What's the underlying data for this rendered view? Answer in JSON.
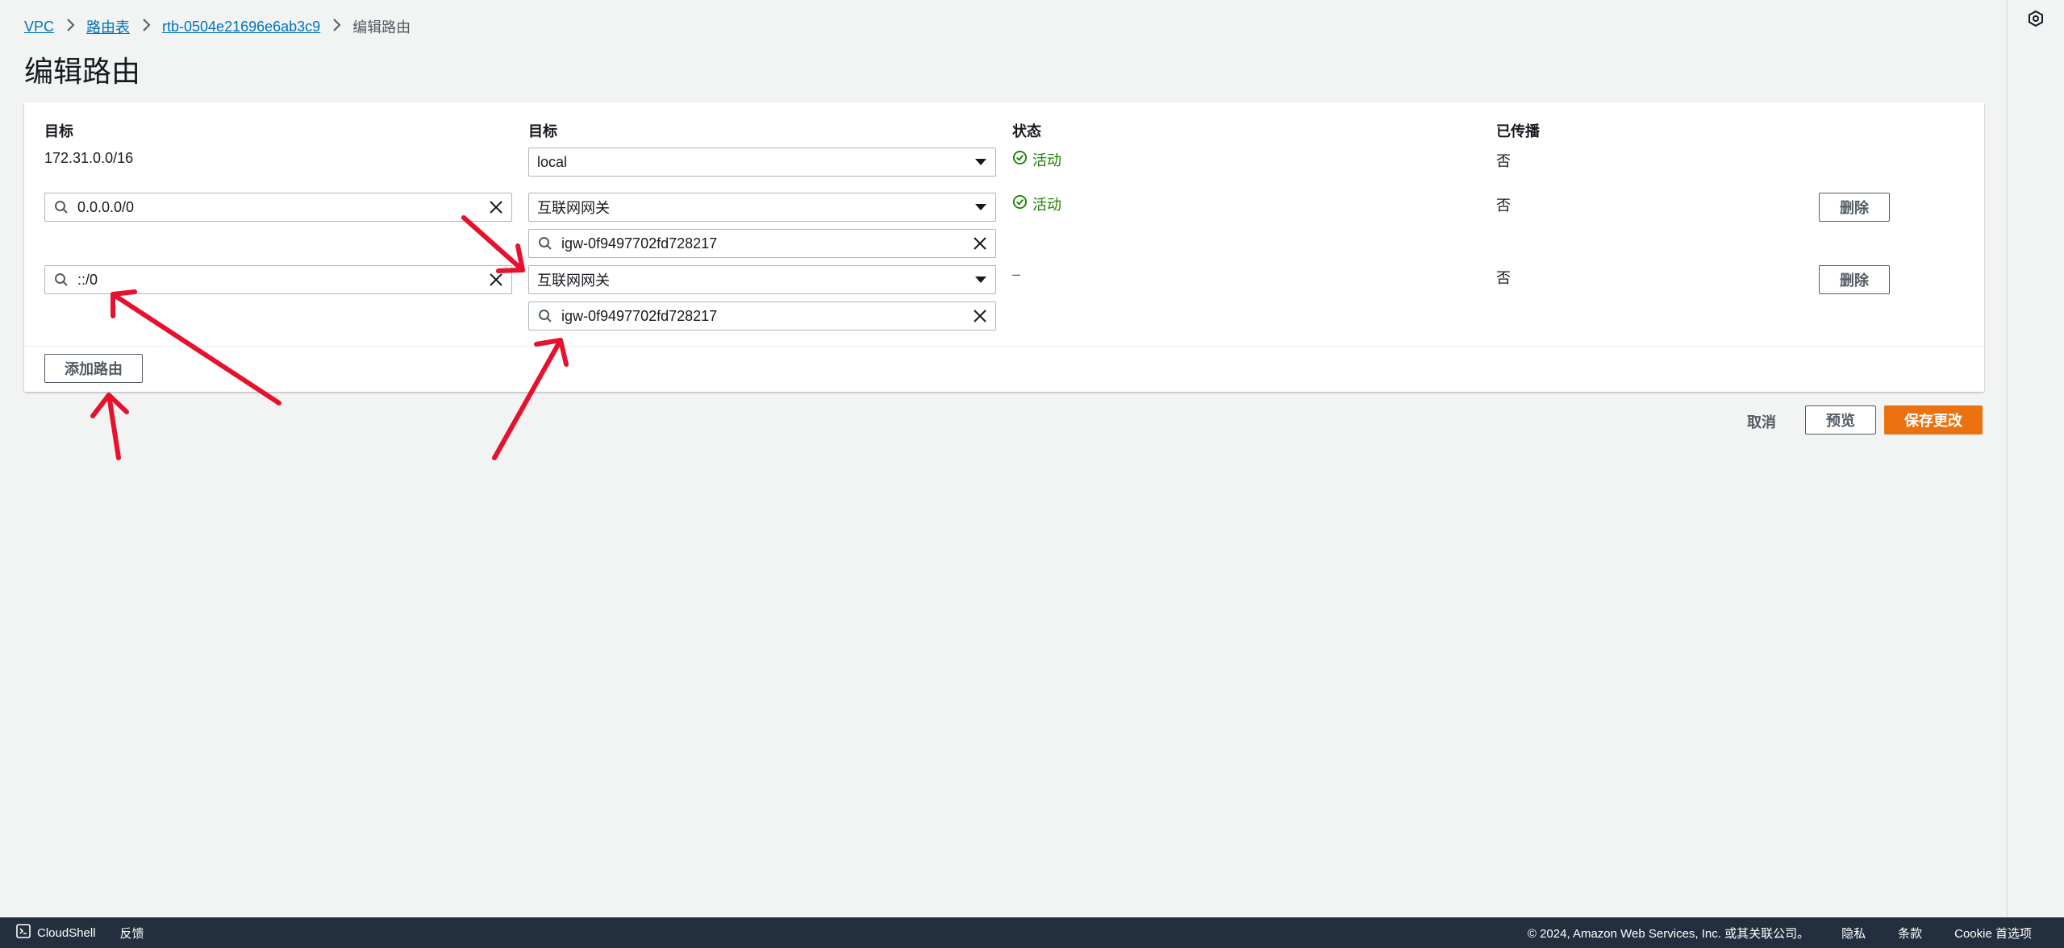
{
  "breadcrumb": {
    "items": [
      "VPC",
      "路由表",
      "rtb-0504e21696e6ab3c9"
    ],
    "current": "编辑路由"
  },
  "page_title": "编辑路由",
  "table": {
    "headers": [
      "目标",
      "目标",
      "状态",
      "已传播"
    ],
    "rows": [
      {
        "destination": "172.31.0.0/16",
        "target_type": "local",
        "target_id": "",
        "status": "活动",
        "propagated": "否"
      },
      {
        "destination": "0.0.0.0/0",
        "target_type": "互联网网关",
        "target_id": "igw-0f9497702fd728217",
        "status": "活动",
        "propagated": "否",
        "remove": "删除"
      },
      {
        "destination": "::/0",
        "target_type": "互联网网关",
        "target_id": "igw-0f9497702fd728217",
        "status": "–",
        "propagated": "否",
        "remove": "删除"
      }
    ],
    "add_route": "添加路由"
  },
  "actions": {
    "cancel": "取消",
    "preview": "预览",
    "save": "保存更改"
  },
  "footer": {
    "cloudshell": "CloudShell",
    "feedback": "反馈",
    "copyright": "© 2024, Amazon Web Services, Inc. 或其关联公司。",
    "privacy": "隐私",
    "terms": "条款",
    "cookie": "Cookie 首选项"
  },
  "colors": {
    "link": "#0073bb",
    "status_active": "#1d8102",
    "primary": "#ec7211",
    "annotation_arrow": "#e8112d",
    "footer_bg": "#232f3e"
  },
  "icons": [
    "chevron-right-icon",
    "search-icon",
    "clear-icon",
    "caret-down-icon",
    "status-success-icon",
    "cloudshell-icon",
    "settings-hex-icon"
  ]
}
